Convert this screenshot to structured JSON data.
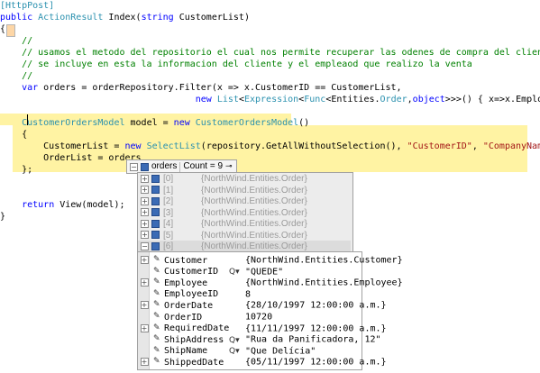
{
  "code": {
    "lines": [
      "[HttpPost]",
      "public ActionResult Index(string CustomerList)",
      "{",
      "    //",
      "    // usamos el metodo del repositorio el cual nos permite recuperar las odenes de compra del cliente",
      "    // se incluye en esta la informacion del cliente y el empleaod que realizo la venta",
      "    //",
      "    var orders = orderRepository.Filter(x => x.CustomerID == CustomerList,",
      "                                    new List<Expression<Func<Entities.Order,object>>>() { x=>x.Employe",
      "",
      "    CustomerOrdersModel model = new CustomerOrdersModel()",
      "    {",
      "        CustomerList = new SelectList(repository.GetAllWithoutSelection(), \"CustomerID\", \"CompanyName\"),",
      "        OrderList = orders",
      "    };",
      "",
      "",
      "    return View(model);",
      "}"
    ]
  },
  "datatip": {
    "root_name": "orders",
    "root_count": "Count = 9",
    "items": [
      {
        "index": "[0]",
        "value": "{NorthWind.Entities.Order}"
      },
      {
        "index": "[1]",
        "value": "{NorthWind.Entities.Order}"
      },
      {
        "index": "[2]",
        "value": "{NorthWind.Entities.Order}"
      },
      {
        "index": "[3]",
        "value": "{NorthWind.Entities.Order}"
      },
      {
        "index": "[4]",
        "value": "{NorthWind.Entities.Order}"
      },
      {
        "index": "[5]",
        "value": "{NorthWind.Entities.Order}"
      },
      {
        "index": "[6]",
        "value": "{NorthWind.Entities.Order}"
      }
    ],
    "properties": [
      {
        "name": "Customer",
        "value": "{NorthWind.Entities.Customer}",
        "expandable": true,
        "magnifier": false
      },
      {
        "name": "CustomerID",
        "value": "\"QUEDE\"",
        "expandable": false,
        "magnifier": true
      },
      {
        "name": "Employee",
        "value": "{NorthWind.Entities.Employee}",
        "expandable": true,
        "magnifier": false
      },
      {
        "name": "EmployeeID",
        "value": "8",
        "expandable": false,
        "magnifier": false
      },
      {
        "name": "OrderDate",
        "value": "{28/10/1997 12:00:00 a.m.}",
        "expandable": true,
        "magnifier": false
      },
      {
        "name": "OrderID",
        "value": "10720",
        "expandable": false,
        "magnifier": false
      },
      {
        "name": "RequiredDate",
        "value": "{11/11/1997 12:00:00 a.m.}",
        "expandable": true,
        "magnifier": false
      },
      {
        "name": "ShipAddress",
        "value": "\"Rua da Panificadora, 12\"",
        "expandable": false,
        "magnifier": true
      },
      {
        "name": "ShipName",
        "value": "\"Que Delícia\"",
        "expandable": false,
        "magnifier": true
      },
      {
        "name": "ShippedDate",
        "value": "{05/11/1997 12:00:00 a.m.}",
        "expandable": true,
        "magnifier": false
      }
    ]
  },
  "colors": {
    "keyword": "#0000ff",
    "type": "#2b91af",
    "comment": "#008000",
    "string": "#a31515",
    "highlight": "#fff3a3"
  }
}
